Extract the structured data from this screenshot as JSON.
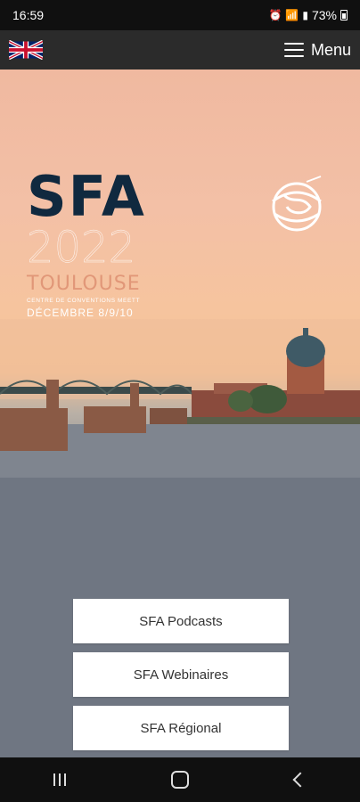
{
  "status_bar": {
    "time": "16:59",
    "battery": "73%",
    "icons": [
      "alarm-icon",
      "wifi-icon",
      "signal-icon",
      "battery-icon"
    ]
  },
  "app_bar": {
    "language_flag": "uk-flag-icon",
    "menu_label": "Menu"
  },
  "hero": {
    "logo_title": "SFA",
    "logo_year": "2022",
    "logo_city": "TOULOUSE",
    "logo_venue": "CENTRE DE CONVENTIONS MEETT",
    "logo_dates": "DÉCEMBRE 8/9/10"
  },
  "buttons": {
    "podcasts": "SFA Podcasts",
    "webinaires": "SFA Webinaires",
    "regional": "SFA Régional"
  },
  "nav_bar": {
    "icons": [
      "recents-icon",
      "home-icon",
      "back-icon"
    ]
  },
  "colors": {
    "app_bar": "#2b2b2b",
    "logo_navy": "#10293f",
    "button_bg": "#ffffff"
  }
}
